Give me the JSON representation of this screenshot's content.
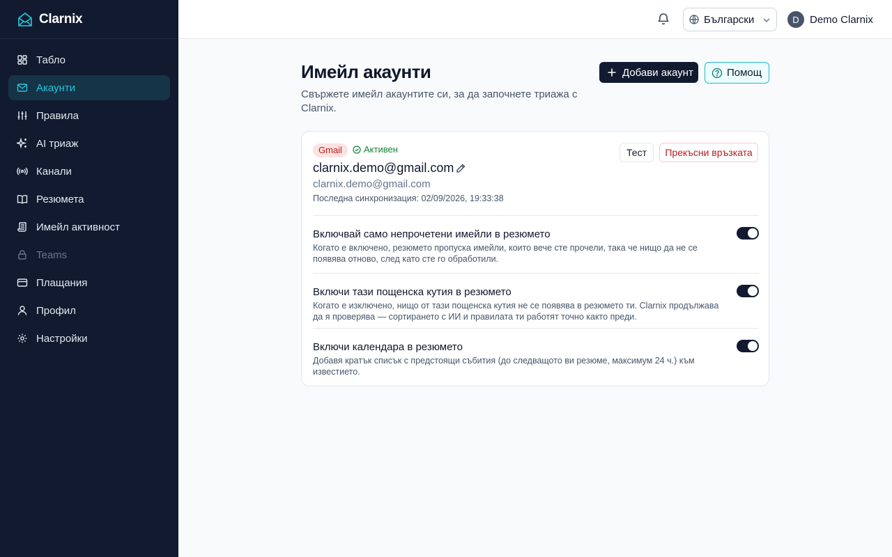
{
  "app": {
    "name": "Clarnix"
  },
  "sidebar": {
    "items": [
      {
        "label": "Табло",
        "icon": "dashboard-icon"
      },
      {
        "label": "Акаунти",
        "icon": "mail-icon",
        "active": true
      },
      {
        "label": "Правила",
        "icon": "sliders-icon"
      },
      {
        "label": "AI триаж",
        "icon": "sparkles-icon"
      },
      {
        "label": "Канали",
        "icon": "radio-icon"
      },
      {
        "label": "Резюмета",
        "icon": "book-icon"
      },
      {
        "label": "Имейл активност",
        "icon": "scroll-icon"
      },
      {
        "label": "Teams",
        "icon": "lock-icon",
        "disabled": true
      },
      {
        "label": "Плащания",
        "icon": "credit-card-icon"
      },
      {
        "label": "Профил",
        "icon": "user-icon"
      },
      {
        "label": "Настройки",
        "icon": "gear-icon"
      }
    ]
  },
  "topbar": {
    "language": "Български",
    "user": {
      "initial": "D",
      "name": "Demo Clarnix"
    }
  },
  "page": {
    "title": "Имейл акаунти",
    "subtitle": "Свържете имейл акаунтите си, за да започнете триажа с Clarnix.",
    "add_button": "Добави акаунт",
    "help_button": "Помощ"
  },
  "account": {
    "provider": "Gmail",
    "status": "Активен",
    "email": "clarnix.demo@gmail.com",
    "address": "clarnix.demo@gmail.com",
    "last_sync": "Последна синхронизация: 02/09/2026, 19:33:38",
    "test_button": "Тест",
    "disconnect_button": "Прекъсни връзката",
    "settings": [
      {
        "title": "Включвай само непрочетени имейли в резюмето",
        "description": "Когато е включено, резюмето пропуска имейли, които вече сте прочели, така че нищо да не се появява отново, след като сте го обработили.",
        "enabled": true
      },
      {
        "title": "Включи тази пощенска кутия в резюмето",
        "description": "Когато е изключено, нищо от тази пощенска кутия не се появява в резюмето ти. Clarnix продължава да я проверява — сортирането с ИИ и правилата ти работят точно както преди.",
        "enabled": true
      },
      {
        "title": "Включи календара в резюмето",
        "description": "Добавя кратък списък с предстоящи събития (до следващото ви резюме, максимум 24 ч.) към известието.",
        "enabled": true
      }
    ]
  },
  "colors": {
    "sidebar_bg": "#111a2e",
    "accent": "#22b8cf",
    "danger": "#b91c1c",
    "success": "#15803d"
  }
}
